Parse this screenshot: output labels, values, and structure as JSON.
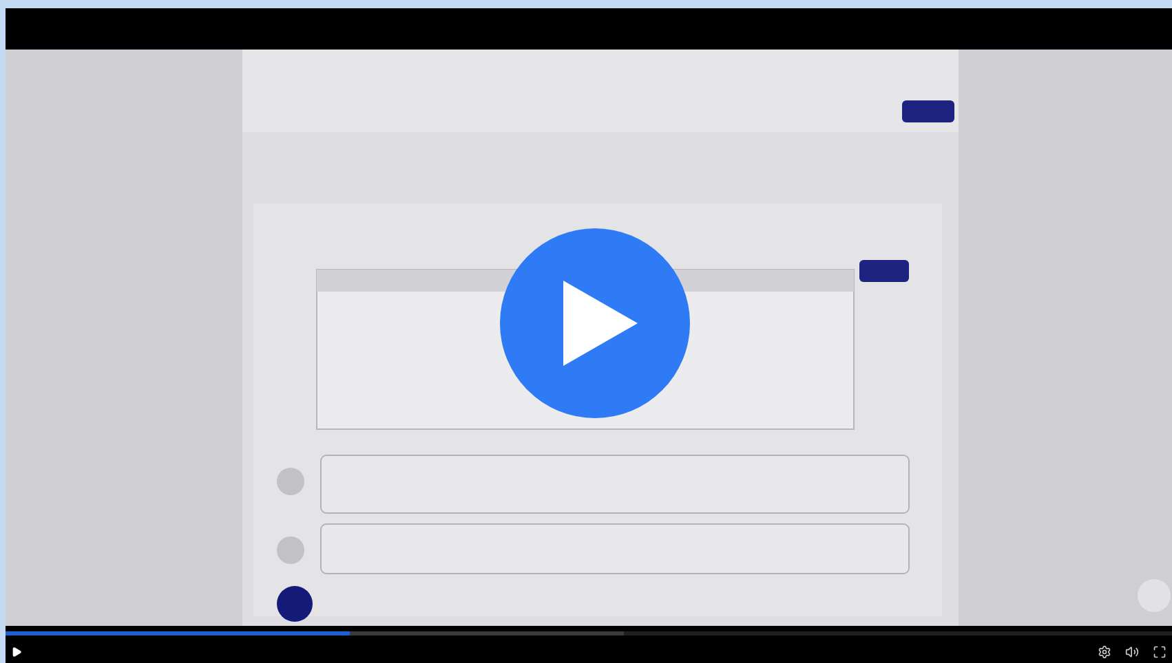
{
  "progress": {
    "level": 0.295
  },
  "buffer": {
    "level": 0.53
  }
}
